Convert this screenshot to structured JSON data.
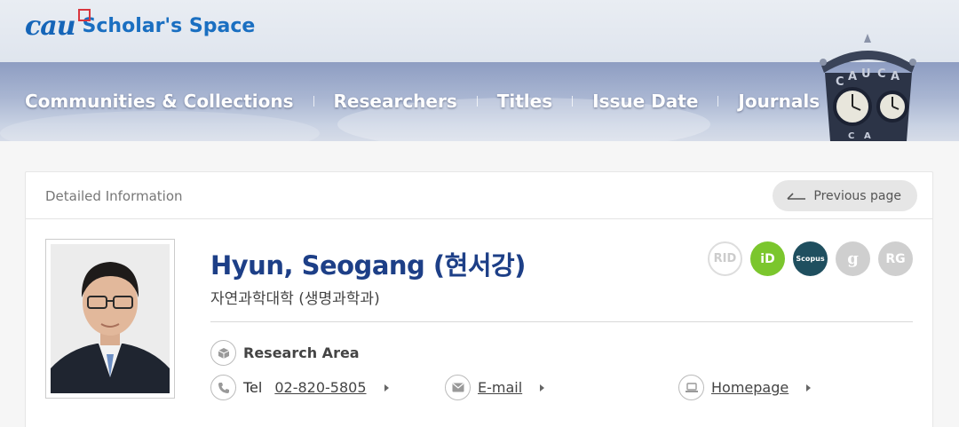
{
  "header": {
    "logo_mark": "cau",
    "site_title": "Scholar's Space"
  },
  "nav": {
    "items": [
      {
        "label": "Communities & Collections"
      },
      {
        "label": "Researchers"
      },
      {
        "label": "Titles"
      },
      {
        "label": "Issue Date"
      },
      {
        "label": "Journals"
      }
    ]
  },
  "clock_tower": {
    "letters": "CAU"
  },
  "card": {
    "title": "Detailed Information",
    "previous_button_label": "Previous page"
  },
  "researcher": {
    "name": "Hyun, Seogang (현서강)",
    "department": "자연과학대학 (생명과학과)",
    "research_area_label": "Research Area",
    "tel_label": "Tel",
    "tel_value": "02-820-5805",
    "email_label": "E-mail",
    "homepage_label": "Homepage"
  },
  "id_badges": [
    {
      "label": "RID",
      "icon": "researcherid-icon"
    },
    {
      "label": "iD",
      "icon": "orcid-icon",
      "color": "#7bc62d"
    },
    {
      "label": "Scopus",
      "icon": "scopus-icon",
      "color": "#1f4f5f"
    },
    {
      "label": "g",
      "icon": "google-scholar-icon"
    },
    {
      "label": "RG",
      "icon": "researchgate-icon"
    }
  ],
  "colors": {
    "brand_blue": "#1a6fc1",
    "name_blue": "#1d3f87",
    "orcid_green": "#7bc62d",
    "scopus_teal": "#1f4f5f"
  }
}
